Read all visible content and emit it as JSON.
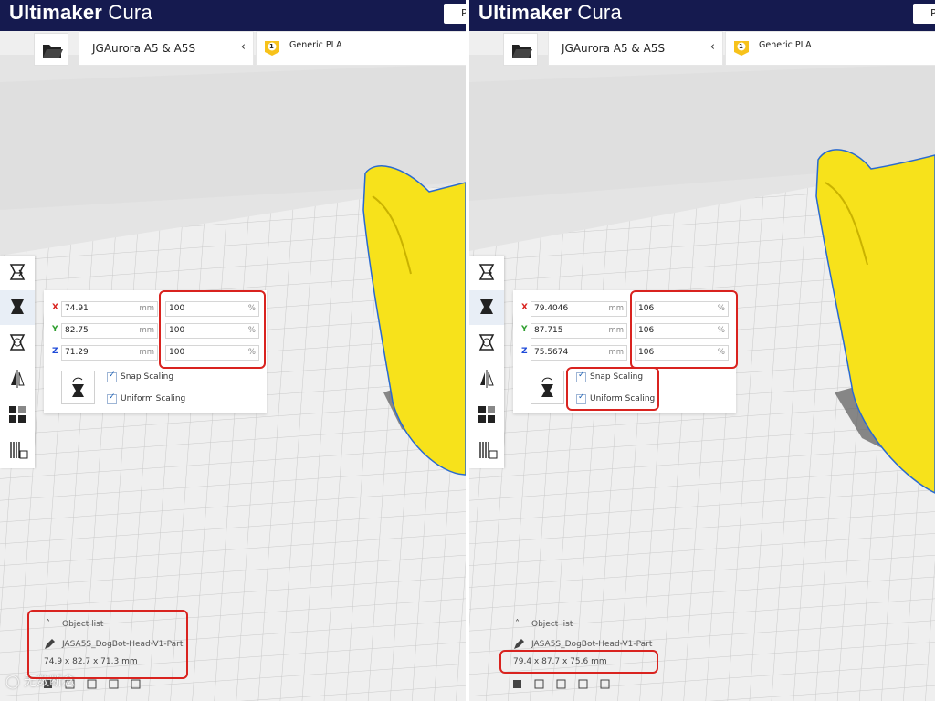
{
  "app": {
    "brand_bold": "Ultimaker",
    "brand_light": "Cura",
    "top_button_label": "P"
  },
  "printer": {
    "name": "JGAurora A5 & A5S"
  },
  "material": {
    "extruder_number": "1",
    "name": "Generic PLA"
  },
  "object_list": {
    "title": "Object list",
    "object_name": "JASA5S_DogBot-Head-V1-Part"
  },
  "units": {
    "mm": "mm",
    "percent": "%"
  },
  "checkboxes": {
    "snap_label": "Snap Scaling",
    "uniform_label": "Uniform Scaling"
  },
  "panels": [
    {
      "scale": {
        "x_mm": "74.91",
        "y_mm": "82.75",
        "z_mm": "71.29",
        "x_pct": "100",
        "y_pct": "100",
        "z_pct": "100",
        "snap_checked": true,
        "uniform_checked": true
      },
      "dimensions": "74.9 x 82.7 x 71.3 mm"
    },
    {
      "scale": {
        "x_mm": "79.4046",
        "y_mm": "87.715",
        "z_mm": "75.5674",
        "x_pct": "106",
        "y_pct": "106",
        "z_pct": "106",
        "snap_checked": true,
        "uniform_checked": true
      },
      "dimensions": "79.4 x 87.7 x 75.6 mm"
    }
  ],
  "axes": {
    "x": "X",
    "y": "Y",
    "z": "Z"
  },
  "colors": {
    "topbar": "#151a4f",
    "model": "#f7e21b",
    "highlight": "#d9231f",
    "axis_x": "#d9231f",
    "axis_y": "#2e9e2e",
    "axis_z": "#1f4bd9"
  }
}
